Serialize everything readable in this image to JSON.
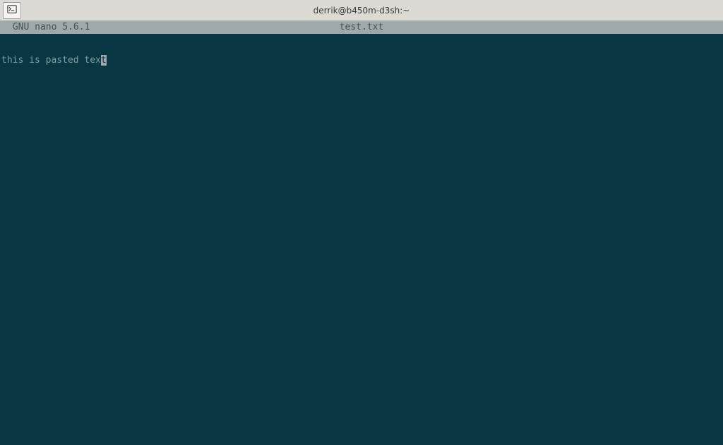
{
  "window": {
    "title": "derrik@b450m-d3sh:~"
  },
  "nano": {
    "app_name": " GNU nano 5.6.1",
    "filename": "test.txt"
  },
  "editor": {
    "line1_pre": "this is pasted tex",
    "line1_cursor": "t"
  }
}
